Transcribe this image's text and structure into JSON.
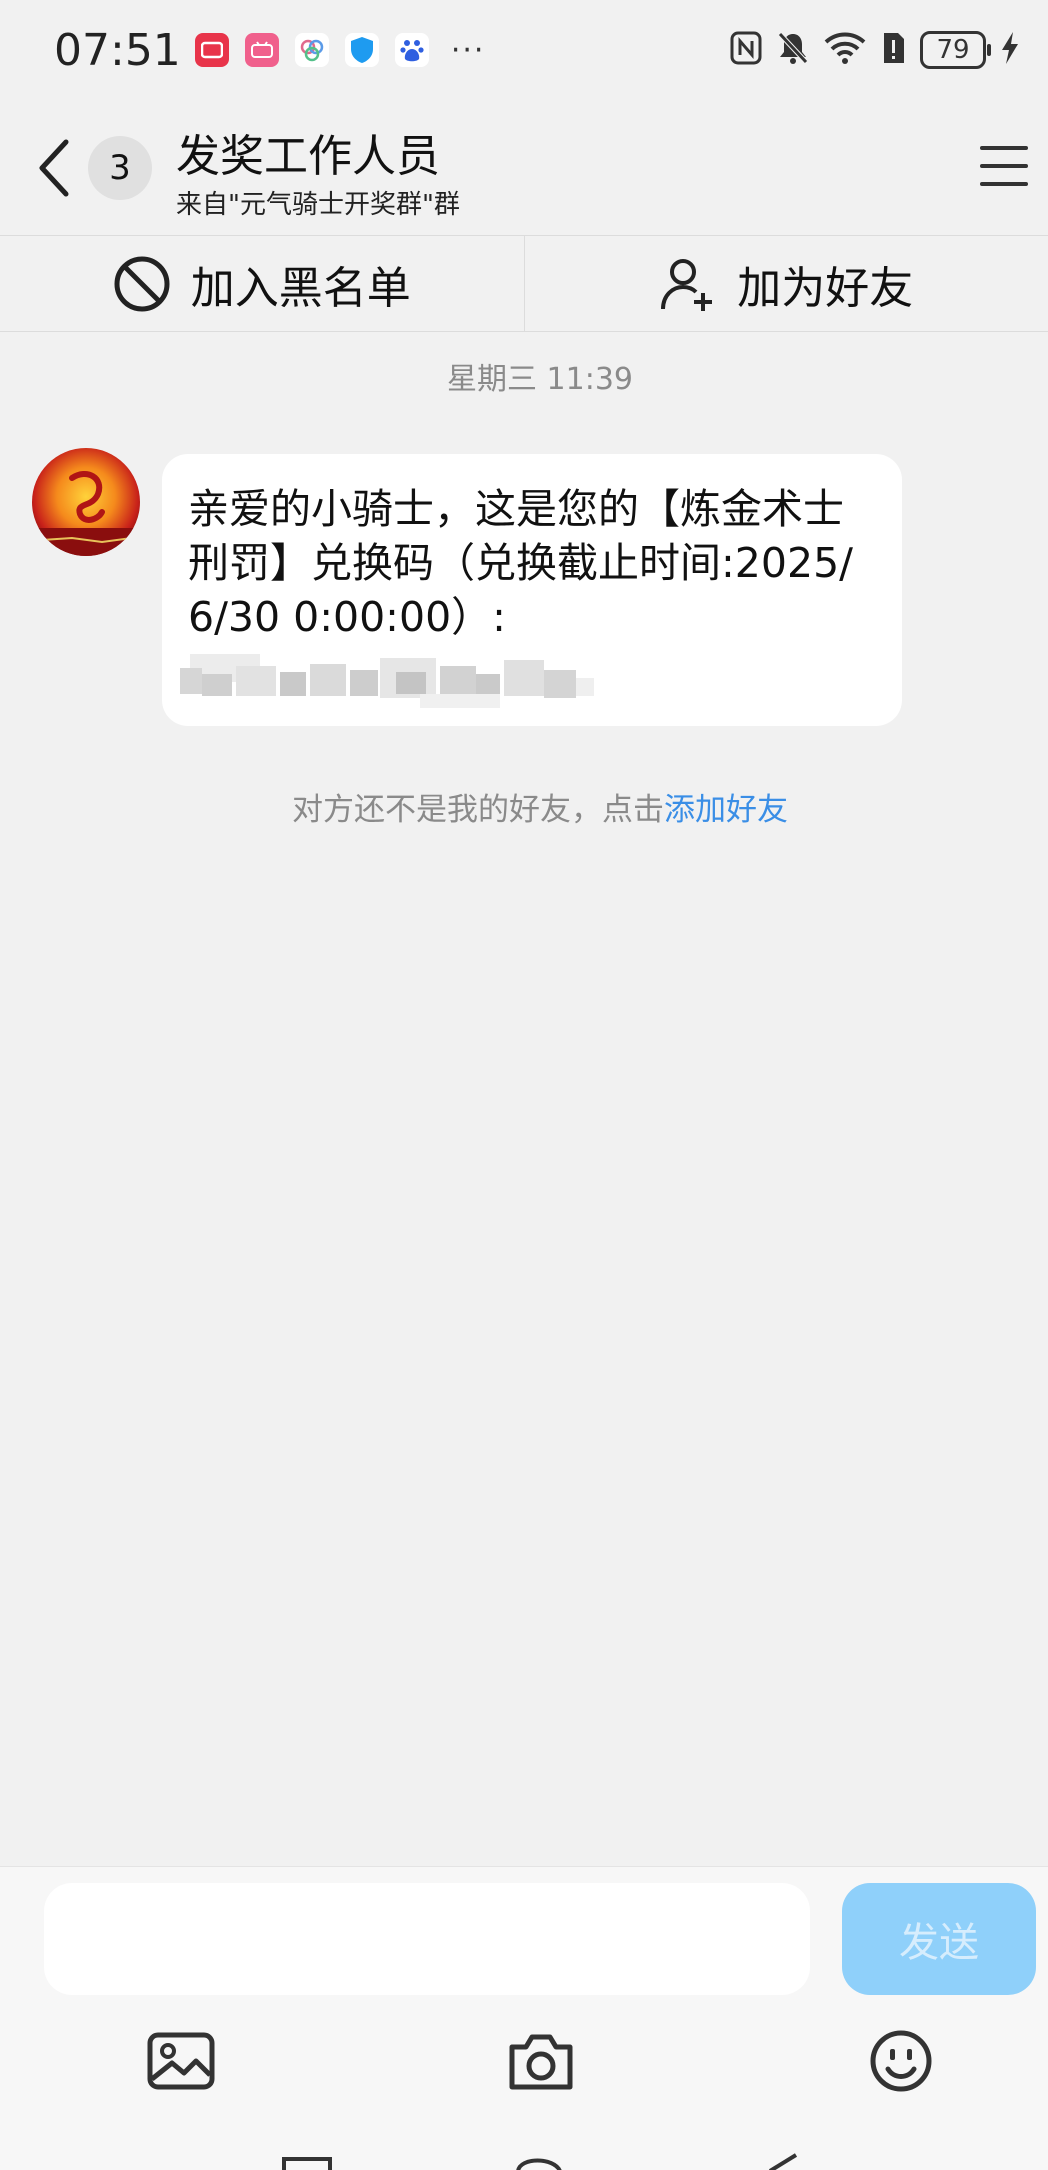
{
  "status_bar": {
    "time": "07:51",
    "more": "···",
    "battery": "79",
    "notification_icons": [
      "mail-app-icon",
      "bilibili-icon",
      "photos-app-icon",
      "shield-app-icon",
      "baidu-icon"
    ]
  },
  "header": {
    "back_label": "",
    "unread_count": "3",
    "title": "发奖工作人员",
    "subtitle": "来自\"元气骑士开奖群\"群"
  },
  "actions": {
    "blacklist_label": "加入黑名单",
    "add_friend_label": "加为好友"
  },
  "chat": {
    "timestamp": "星期三 11:39",
    "message_text": "亲爱的小骑士，这是您的【炼金术士刑罚】兑换码（兑换截止时间:2025/6/30 0:00:00）:",
    "friend_notice_prefix": "对方还不是我的好友，点击",
    "friend_notice_link": "添加好友"
  },
  "input": {
    "placeholder": "",
    "send_label": "发送"
  },
  "toolbar": [
    "image-icon",
    "camera-icon",
    "emoji-icon"
  ],
  "colors": {
    "background": "#f1f1f1",
    "bubble": "#ffffff",
    "link": "#3a8ee6",
    "send_button": "#8fd0fa"
  }
}
